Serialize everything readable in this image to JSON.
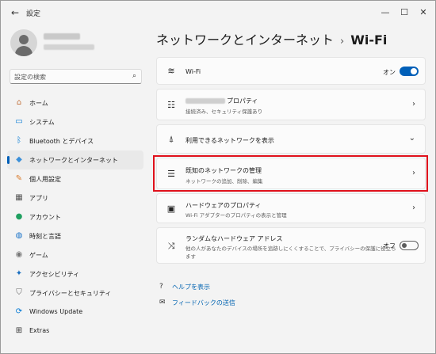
{
  "window": {
    "title": "設定",
    "back_glyph": "←",
    "minimize_glyph": "—",
    "maximize_glyph": "☐",
    "close_glyph": "✕"
  },
  "search": {
    "placeholder": "設定の検索",
    "icon": "⌕"
  },
  "sidebar": {
    "items": [
      {
        "label": "ホーム",
        "icon": "⌂",
        "color": "#c2703a"
      },
      {
        "label": "システム",
        "icon": "▭",
        "color": "#0078d4"
      },
      {
        "label": "Bluetooth とデバイス",
        "icon": "ᛒ",
        "color": "#0078d4"
      },
      {
        "label": "ネットワークとインターネット",
        "icon": "◆",
        "color": "#3a8fd9",
        "active": true
      },
      {
        "label": "個人用設定",
        "icon": "✎",
        "color": "#d97b2b"
      },
      {
        "label": "アプリ",
        "icon": "▦",
        "color": "#555"
      },
      {
        "label": "アカウント",
        "icon": "●",
        "color": "#20a060"
      },
      {
        "label": "時刻と言語",
        "icon": "◍",
        "color": "#1a73c8"
      },
      {
        "label": "ゲーム",
        "icon": "◉",
        "color": "#777"
      },
      {
        "label": "アクセシビリティ",
        "icon": "✦",
        "color": "#1a6fc0"
      },
      {
        "label": "プライバシーとセキュリティ",
        "icon": "⛉",
        "color": "#666"
      },
      {
        "label": "Windows Update",
        "icon": "⟳",
        "color": "#0078d4"
      },
      {
        "label": "Extras",
        "icon": "⊞",
        "color": "#333"
      }
    ]
  },
  "breadcrumb": {
    "parent": "ネットワークとインターネット",
    "separator": "›",
    "current": "Wi-Fi"
  },
  "cards": {
    "wifi": {
      "title": "Wi-Fi",
      "icon": "≋",
      "toggle_label": "オン",
      "toggle_on": true
    },
    "properties": {
      "title": "プロパティ",
      "subtitle": "接続済み、セキュリティ保護あり",
      "icon": "☷",
      "chevron": "›"
    },
    "available": {
      "title": "利用できるネットワークを表示",
      "icon": "⍋",
      "chevron": "⌄"
    },
    "known": {
      "title": "既知のネットワークの管理",
      "subtitle": "ネットワークの追加、削除、編集",
      "icon": "☰",
      "chevron": "›"
    },
    "hardware": {
      "title": "ハードウェアのプロパティ",
      "subtitle": "Wi-Fi アダプターのプロパティの表示と管理",
      "icon": "▣",
      "chevron": "›"
    },
    "random": {
      "title": "ランダムなハードウェア アドレス",
      "subtitle_line1": "他の人があなたのデバイスの場所を追跡しにくくすることで、プライバシーの保護に役立ち",
      "subtitle_line2": "ます",
      "icon": "⤨",
      "toggle_label": "オフ",
      "toggle_on": false
    }
  },
  "links": {
    "help": {
      "label": "ヘルプを表示",
      "icon": "?"
    },
    "feedback": {
      "label": "フィードバックの送信",
      "icon": "✉"
    }
  },
  "colors": {
    "accent": "#005fb8",
    "highlight": "#e0111c",
    "link": "#0063b1"
  }
}
